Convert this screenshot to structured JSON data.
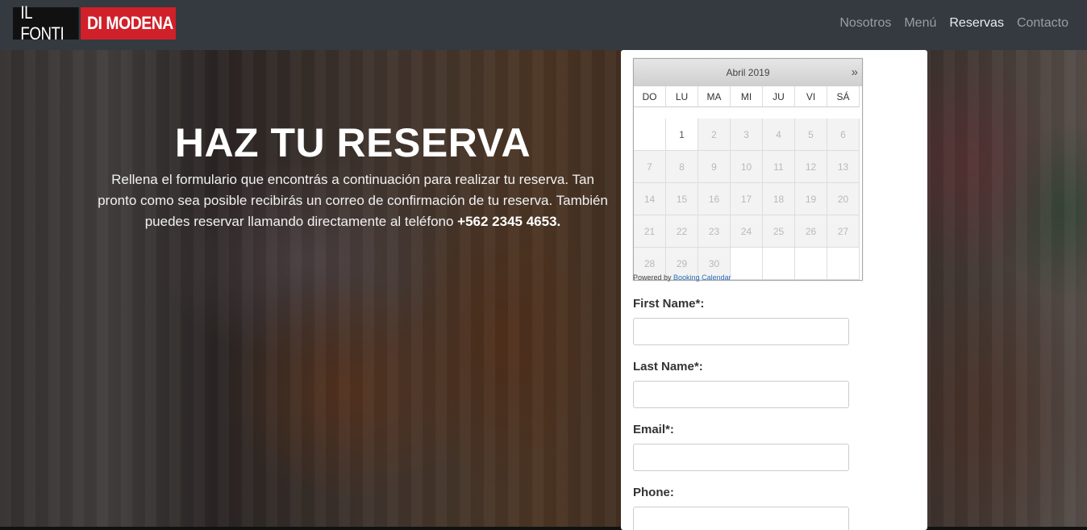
{
  "navbar": {
    "logo_part1": "IL FONTI",
    "logo_part2": "DI MODENA",
    "links": [
      {
        "label": "Nosotros",
        "active": false
      },
      {
        "label": "Menú",
        "active": false
      },
      {
        "label": "Reservas",
        "active": true
      },
      {
        "label": "Contacto",
        "active": false
      }
    ]
  },
  "hero": {
    "title": "HAZ TU RESERVA",
    "description": "Rellena el formulario que encontrás a continuación para realizar tu reserva. Tan pronto como sea posible recibirás un correo de confirmación de tu reserva. También puedes reservar llamando directamente al teléfono",
    "phone": "+562 2345 4653."
  },
  "calendar": {
    "month_label": "Abril 2019",
    "next_label": "»",
    "weekdays": [
      "DO",
      "LU",
      "MA",
      "MI",
      "JU",
      "VI",
      "SÁ"
    ],
    "days": [
      [
        "",
        "1",
        "2",
        "3",
        "4",
        "5",
        "6"
      ],
      [
        "7",
        "8",
        "9",
        "10",
        "11",
        "12",
        "13"
      ],
      [
        "14",
        "15",
        "16",
        "17",
        "18",
        "19",
        "20"
      ],
      [
        "21",
        "22",
        "23",
        "24",
        "25",
        "26",
        "27"
      ],
      [
        "28",
        "29",
        "30",
        "",
        "",
        "",
        ""
      ]
    ],
    "available_days": [
      "1"
    ],
    "powered_text": "Powered by",
    "powered_link": "Booking Calendar"
  },
  "form": {
    "first_name_label": "First Name*:",
    "last_name_label": "Last Name*:",
    "email_label": "Email*:",
    "phone_label": "Phone:"
  },
  "colors": {
    "navbar": "#343a40",
    "logo_red": "#d0202a",
    "nav_link": "#9a9ea3",
    "nav_link_active": "#e9ecef"
  }
}
